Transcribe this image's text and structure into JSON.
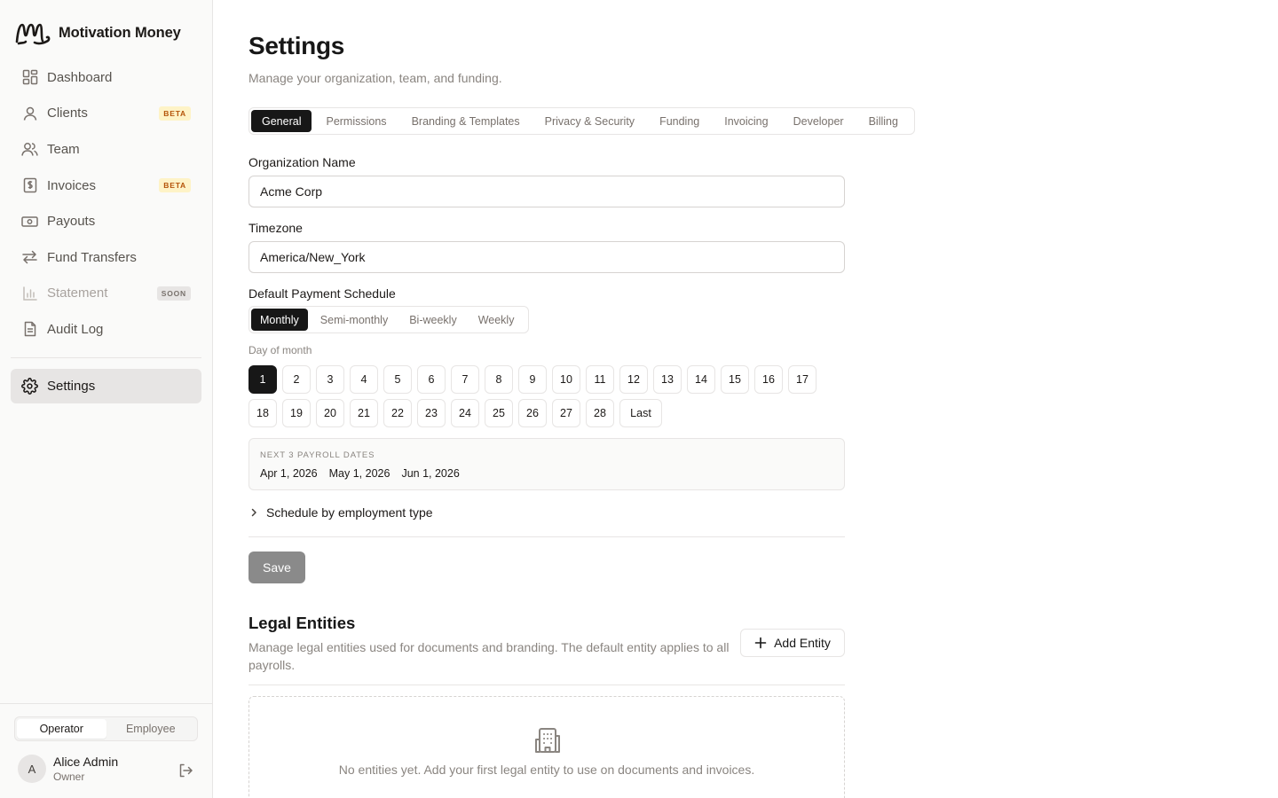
{
  "brand": {
    "name": "Motivation Money"
  },
  "sidebar": {
    "items": [
      {
        "label": "Dashboard",
        "icon": "dashboard-icon"
      },
      {
        "label": "Clients",
        "icon": "user-icon",
        "badge": "BETA"
      },
      {
        "label": "Team",
        "icon": "users-icon"
      },
      {
        "label": "Invoices",
        "icon": "invoice-icon",
        "badge": "BETA"
      },
      {
        "label": "Payouts",
        "icon": "banknote-icon"
      },
      {
        "label": "Fund Transfers",
        "icon": "arrows-left-right-icon"
      },
      {
        "label": "Statement",
        "icon": "bar-chart-icon",
        "badge": "SOON",
        "disabled": true
      },
      {
        "label": "Audit Log",
        "icon": "document-icon"
      }
    ],
    "settings_label": "Settings",
    "role_toggle": {
      "operator": "Operator",
      "employee": "Employee",
      "selected": "Operator"
    },
    "user": {
      "initial": "A",
      "name": "Alice Admin",
      "role": "Owner"
    }
  },
  "page": {
    "title": "Settings",
    "subtitle": "Manage your organization, team, and funding."
  },
  "tabs": [
    "General",
    "Permissions",
    "Branding & Templates",
    "Privacy & Security",
    "Funding",
    "Invoicing",
    "Developer",
    "Billing"
  ],
  "active_tab": "General",
  "form": {
    "org_name_label": "Organization Name",
    "org_name_value": "Acme Corp",
    "timezone_label": "Timezone",
    "timezone_value": "America/New_York",
    "schedule_label": "Default Payment Schedule",
    "schedule_options": [
      "Monthly",
      "Semi-monthly",
      "Bi-weekly",
      "Weekly"
    ],
    "schedule_selected": "Monthly",
    "day_label": "Day of month",
    "days_row1": [
      "1",
      "2",
      "3",
      "4",
      "5",
      "6",
      "7",
      "8",
      "9",
      "10",
      "11",
      "12",
      "13",
      "14",
      "15",
      "16",
      "17"
    ],
    "days_row2": [
      "18",
      "19",
      "20",
      "21",
      "22",
      "23",
      "24",
      "25",
      "26",
      "27",
      "28",
      "Last"
    ],
    "selected_day": "1",
    "next_dates_title": "NEXT 3 PAYROLL DATES",
    "next_dates": [
      "Apr 1, 2026",
      "May 1, 2026",
      "Jun 1, 2026"
    ],
    "collapse_label": "Schedule by employment type",
    "save_label": "Save"
  },
  "legal": {
    "title": "Legal Entities",
    "description": "Manage legal entities used for documents and branding. The default entity applies to all payrolls.",
    "add_label": "Add Entity",
    "empty_text": "No entities yet. Add your first legal entity to use on documents and invoices."
  },
  "colors": {
    "accent": "#171717",
    "beta_bg": "#fef3c7",
    "beta_text": "#b45309",
    "muted": "#8a8580"
  }
}
